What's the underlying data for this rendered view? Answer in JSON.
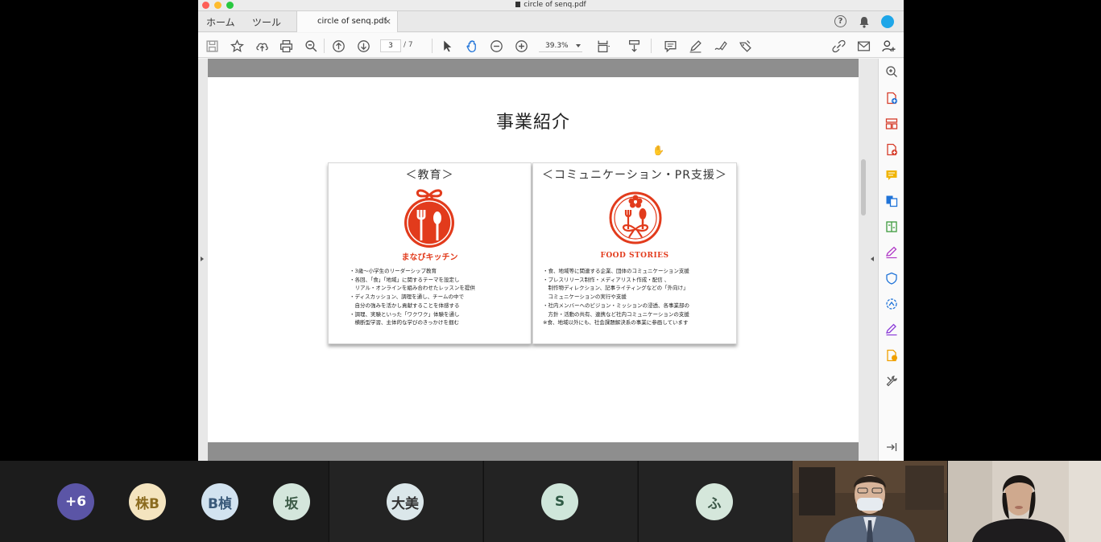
{
  "window": {
    "title": "circle of senq.pdf",
    "nav_home": "ホーム",
    "nav_tools": "ツール",
    "doc_tab": "circle of senq.pdf",
    "doc_tab_close": "×",
    "help": "?"
  },
  "toolbar": {
    "page_current": "3",
    "page_total": "/ 7",
    "zoom": "39.3%"
  },
  "slide": {
    "title": "事業紹介",
    "cards": [
      {
        "heading": "＜教育＞",
        "logo_name": "まなびキッチン",
        "bullets": "・3歳〜小学生のリーダーシップ教育\n・各回、「食」「地域」に関するテーマを設定し\n　リアル・オンラインを組み合わせたレッスンを提供\n・ディスカッション、調理を通し、チームの中で\n　自分の強みを活かし貢献することを体感する\n・調理、実験といった「ワクワク」体験を通し\n　横断型学習、主体的な学びのきっかけを掴む"
      },
      {
        "heading": "＜コミュニケーション・PR支援＞",
        "logo_name": "FOOD STORIES",
        "bullets": "・食、地域等に関連する企業、団体のコミュニケーション支援\n・プレスリリース制作・メディアリスト作成・配信 、\n　制作物ディレクション、記事ライティングなどの「外向け」\n　コミュニケーションの実行や支援\n・社内メンバーへのビジョン・ミッションの浸透、各事業部の\n　方針・活動の共有、連携など社内コミュニケーションの支援\n※食、地域以外にも、社会課題解決系の事業に参画しています"
      }
    ]
  },
  "colors": {
    "accent_red": "#e23b1c",
    "page_bar": "#8e8e8e"
  },
  "participants": [
    {
      "label": "+6",
      "bg": "#5b55a6",
      "fg": "#ffffff"
    },
    {
      "label": "株B",
      "bg": "#f4e4bf",
      "fg": "#8a6a1e"
    },
    {
      "label": "B楨",
      "bg": "#d2e3f0",
      "fg": "#3a5a7a"
    },
    {
      "label": "坂",
      "bg": "#d4e6dc",
      "fg": "#3d5c48"
    },
    {
      "label": "大美",
      "bg": "#dbe7ea",
      "fg": "#333333"
    },
    {
      "label": "S",
      "bg": "#cfe6da",
      "fg": "#2e5a44"
    },
    {
      "label": "ふ",
      "bg": "#d5e7db",
      "fg": "#3b5747"
    }
  ]
}
